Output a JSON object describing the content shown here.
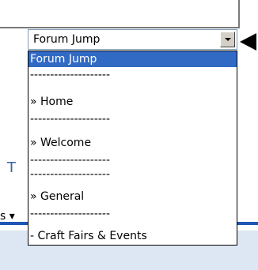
{
  "background": {
    "partial_text_t": "T",
    "partial_text_s": "s ▾"
  },
  "forum_jump": {
    "selected_value": "Forum Jump",
    "options": [
      {
        "label": "Forum Jump",
        "selected": true
      },
      {
        "label": "--------------------",
        "selected": false
      },
      {
        "label": "» Home",
        "selected": false
      },
      {
        "label": "--------------------",
        "selected": false
      },
      {
        "label": "» Welcome",
        "selected": false
      },
      {
        "label": "--------------------",
        "selected": false
      },
      {
        "label": "--------------------",
        "selected": false
      },
      {
        "label": "» General",
        "selected": false
      },
      {
        "label": "--------------------",
        "selected": false
      },
      {
        "label": "- Craft Fairs & Events",
        "selected": false
      }
    ]
  },
  "icons": {
    "dropdown_button": "chevron-down-icon",
    "pointer": "arrow-left-icon"
  },
  "colors": {
    "selection_highlight": "#316ac5",
    "header_accent": "#1f56b5",
    "link_text": "#3366aa"
  }
}
